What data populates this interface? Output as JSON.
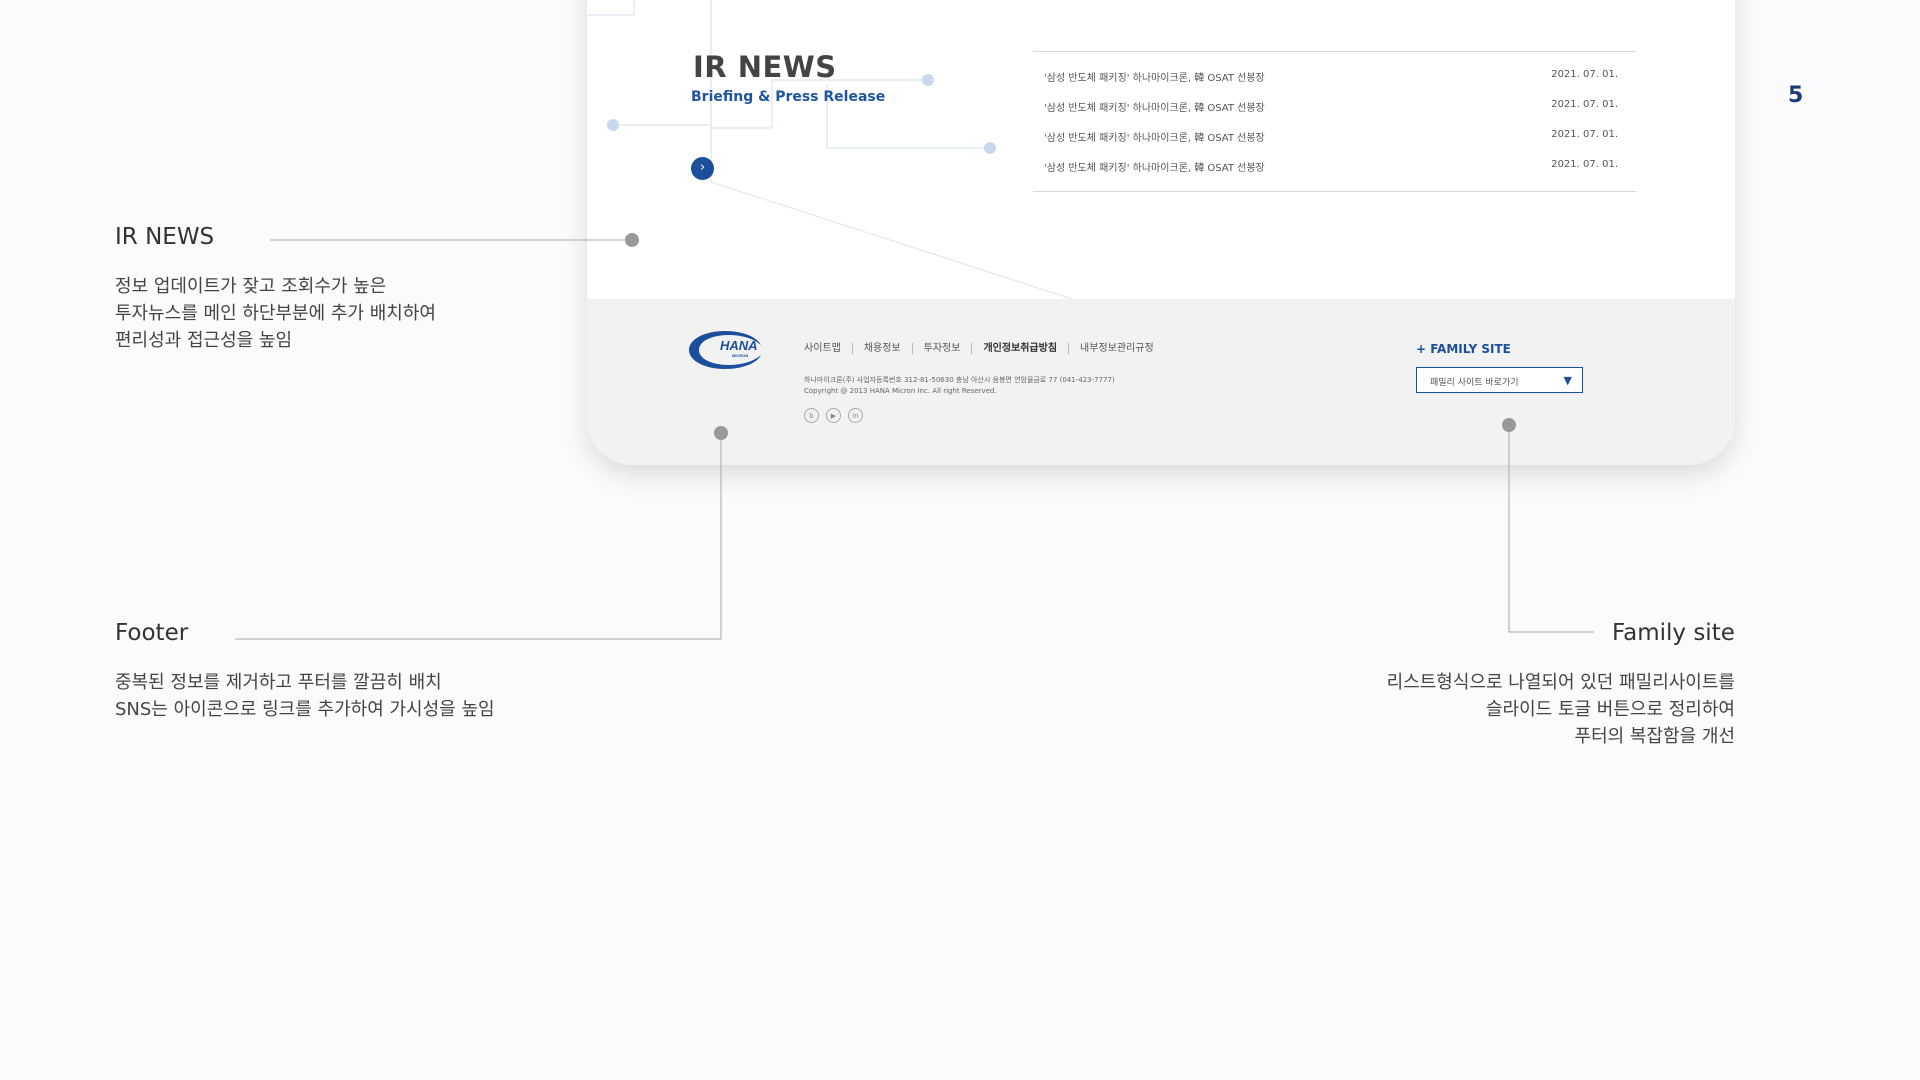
{
  "page_number": "5",
  "mockup": {
    "ir_news": {
      "title": "IR NEWS",
      "subtitle": "Briefing & Press Release",
      "more_button": "›",
      "items": [
        {
          "title": "'삼성 반도체 패키징' 하나마이크론, 韓 OSAT 선봉장",
          "date": "2021. 07. 01."
        },
        {
          "title": "'삼성 반도체 패키징' 하나마이크론, 韓 OSAT 선봉장",
          "date": "2021. 07. 01."
        },
        {
          "title": "'삼성 반도체 패키징' 하나마이크론, 韓 OSAT 선봉장",
          "date": "2021. 07. 01."
        },
        {
          "title": "'삼성 반도체 패키징' 하나마이크론, 韓 OSAT 선봉장",
          "date": "2021. 07. 01."
        }
      ]
    },
    "footer": {
      "logo_text": "HANA",
      "logo_subtext": "MICRON",
      "links": [
        "사이트맵",
        "채용정보",
        "투자정보",
        "개인정보취급방침",
        "내부정보관리규정"
      ],
      "address": "하나마이크론(주) 사업자등록번호 312-81-50630 충남 아산시 음봉면 연암율금로 77 (041-423-7777)",
      "copyright": "Copyright @ 2013 HANA Micron Inc. All right Reserved.",
      "sns": [
        "blog-icon",
        "youtube-icon",
        "linkedin-icon"
      ],
      "sns_glyphs": [
        "b",
        "▶",
        "in"
      ],
      "family_site_title": "+ FAMILY SITE",
      "family_site_select": "패밀리 사이트 바로가기",
      "family_site_caret": "▼"
    }
  },
  "annotations": {
    "ir_news": {
      "title": "IR NEWS",
      "lines": [
        "정보 업데이트가 잦고 조회수가 높은",
        "투자뉴스를 메인 하단부분에 추가 배치하여",
        "편리성과 접근성을 높임"
      ]
    },
    "footer": {
      "title": "Footer",
      "lines": [
        "중복된 정보를 제거하고 푸터를 깔끔히 배치",
        "SNS는 아이콘으로 링크를 추가하여 가시성을 높임"
      ]
    },
    "family_site": {
      "title": "Family site",
      "lines": [
        "리스트형식으로 나열되어 있던 패밀리사이트를",
        "슬라이드 토글 버튼으로 정리하여",
        "푸터의 복잡함을 개선"
      ]
    }
  },
  "colors": {
    "accent_blue": "#1c4f9b",
    "light_dot": "#c9d8ec",
    "connector_gray": "#999999",
    "footer_bg": "#f2f2f2",
    "page_bg": "#fbfbfd"
  }
}
